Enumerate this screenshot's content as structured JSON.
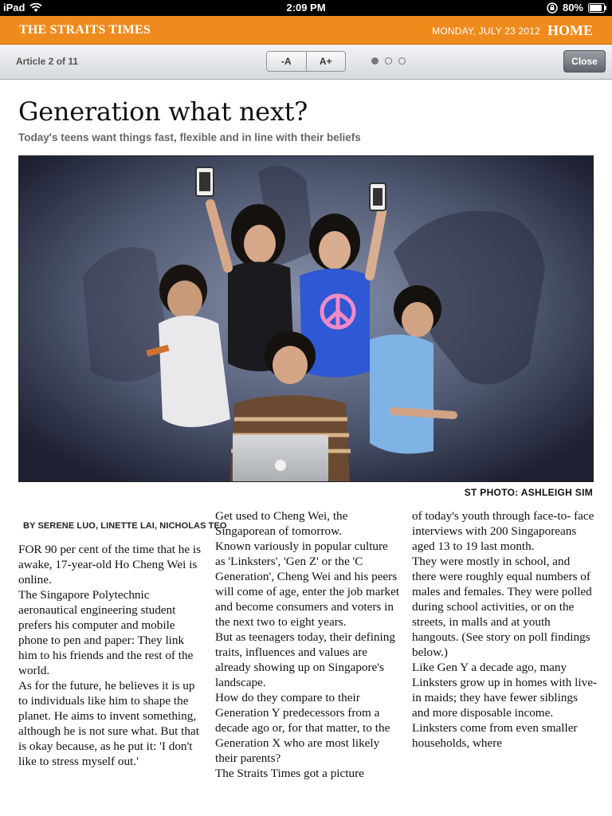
{
  "statusbar": {
    "device": "iPad",
    "time": "2:09 PM",
    "battery": "80%"
  },
  "masthead": {
    "brand": "THE STRAITS TIMES",
    "date": "MONDAY, JULY 23 2012",
    "section": "HOME"
  },
  "toolbar": {
    "article_count": "Article 2 of 11",
    "font_smaller": "-A",
    "font_larger": "A+",
    "pages": 3,
    "current_page": 1,
    "close_label": "Close"
  },
  "article": {
    "headline": "Generation what next?",
    "subhead": "Today's teens want things fast, flexible and in line with their beliefs",
    "photo_credit": "ST PHOTO: ASHLEIGH SIM",
    "byline": "BY SERENE LUO, LINETTE LAI, NICHOLAS TEO",
    "col1": [
      "FOR 90 per cent of the time that he is awake, 17-year-old Ho Cheng Wei is online.",
      "The Singapore Polytechnic aeronautical engineering student prefers his computer and mobile phone to pen and paper: They link him to his friends and the rest of the world.",
      "As for the future, he believes it is up to individuals like him to shape the planet. He aims to invent something, although he is not sure what. But that is okay because, as he put it: 'I don't like to stress myself out.'"
    ],
    "col2": [
      "Get used to Cheng Wei, the Singaporean of tomorrow.",
      "Known variously in popular culture as 'Linksters', 'Gen Z' or the 'C Generation', Cheng Wei and his peers will come of age, enter the job market and become consumers and voters in the next two to eight years.",
      "But as teenagers today, their defining traits, influences and values are already showing up on Singapore's landscape.",
      "How do they compare to their Generation Y predecessors from a decade ago or, for that matter, to the Generation X who are most likely their parents?",
      "The Straits Times got a picture"
    ],
    "col3": [
      "of today's youth through face-to- face interviews with 200 Singaporeans aged 13 to 19 last month.",
      "They were mostly in school, and there were roughly equal numbers of males and females. They were polled during school activities, or on the streets, in malls and at youth hangouts. (See story on poll findings below.)",
      "Like Gen Y a decade ago, many Linksters grow up in homes with live-in maids; they have fewer siblings and more disposable income.",
      "Linksters come from even smaller households, where"
    ]
  }
}
